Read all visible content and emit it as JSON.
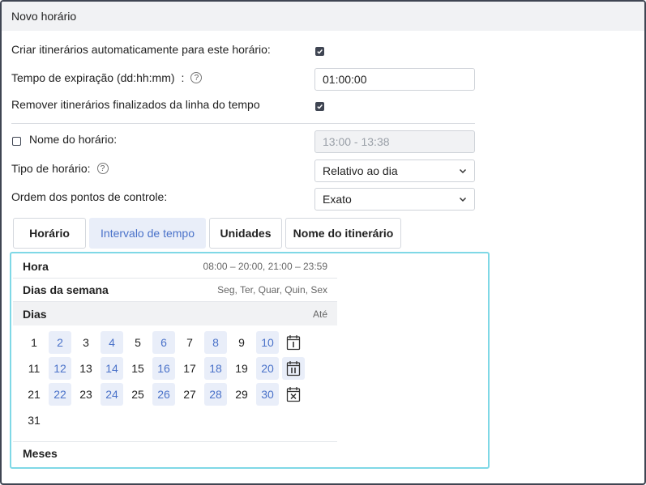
{
  "dialog": {
    "title": "Novo horário"
  },
  "form": {
    "auto_create_label": "Criar itinerários automaticamente para este horário:",
    "auto_create_checked": true,
    "expiration_label": "Tempo de expiração (dd:hh:mm)",
    "expiration_colon": ":",
    "expiration_value": "01:00:00",
    "remove_finished_label": "Remover itinerários finalizados da linha do tempo",
    "remove_finished_checked": true,
    "schedule_name_label": "Nome do horário:",
    "schedule_name_checked": false,
    "schedule_name_value": "13:00 - 13:38",
    "schedule_type_label": "Tipo de horário:",
    "schedule_type_value": "Relativo ao dia",
    "checkpoint_order_label": "Ordem dos pontos de controle:",
    "checkpoint_order_value": "Exato",
    "help_glyph": "?"
  },
  "tabs": [
    {
      "label": "Horário",
      "active": false
    },
    {
      "label": "Intervalo de tempo",
      "active": true
    },
    {
      "label": "Unidades",
      "active": false
    },
    {
      "label": "Nome do itinerário",
      "active": false
    }
  ],
  "panel": {
    "hour_label": "Hora",
    "hour_value": "08:00 – 20:00, 21:00 – 23:59",
    "weekdays_label": "Dias da semana",
    "weekdays_value": "Seg, Ter, Quar, Quin, Sex",
    "days_label": "Dias",
    "days_value": "Até",
    "months_label": "Meses",
    "selected_days": [
      2,
      4,
      6,
      8,
      10,
      12,
      14,
      16,
      18,
      20,
      22,
      24,
      26,
      28,
      30
    ],
    "calendar_icons": [
      "calendar-odd-icon",
      "calendar-even-icon",
      "calendar-clear-icon"
    ]
  },
  "colors": {
    "accent": "#4a72c9",
    "selected_bg": "#e9eef9",
    "panel_border": "#7fd8e6",
    "dark": "#3f4552"
  }
}
